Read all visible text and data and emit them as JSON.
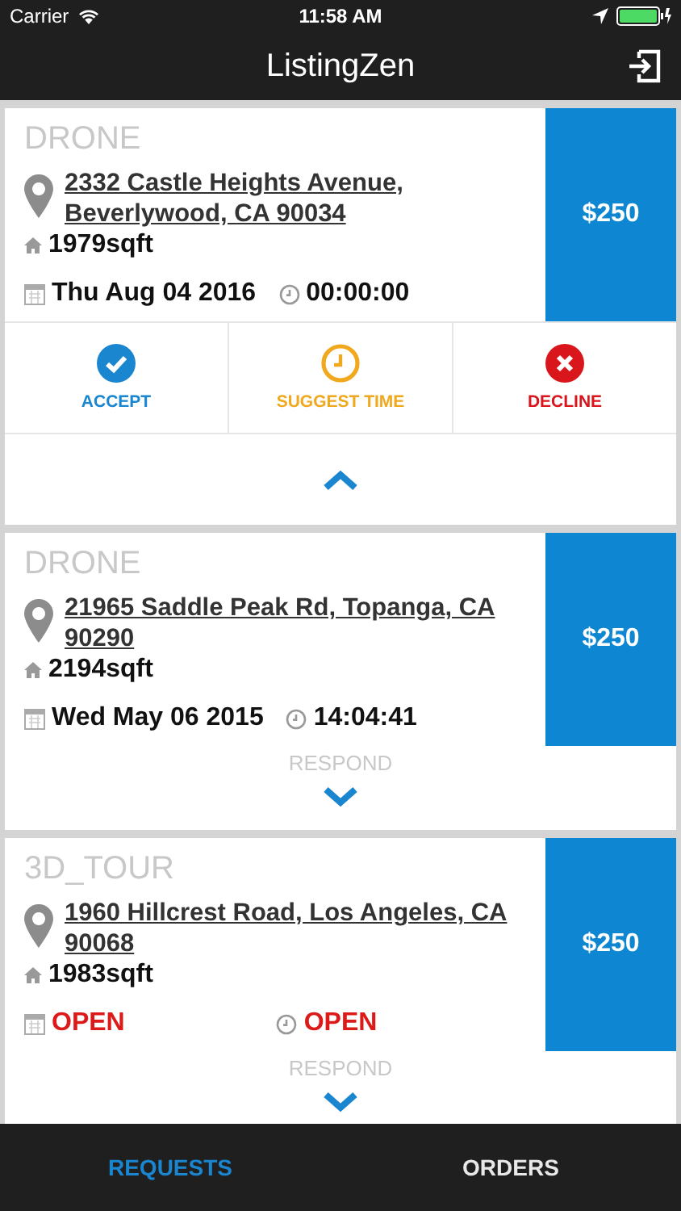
{
  "status_bar": {
    "carrier": "Carrier",
    "time": "11:58 AM"
  },
  "nav": {
    "title": "ListingZen"
  },
  "cards": [
    {
      "type": "DRONE",
      "address": "2332 Castle Heights Avenue, Beverlywood, CA 90034",
      "area": "1979sqft",
      "date": "Thu Aug 04 2016",
      "time": "00:00:00",
      "open": false,
      "price": "$250",
      "expanded": true,
      "actions": [
        {
          "kind": "accept",
          "label": "ACCEPT"
        },
        {
          "kind": "suggest",
          "label": "SUGGEST TIME"
        },
        {
          "kind": "decline",
          "label": "DECLINE"
        }
      ]
    },
    {
      "type": "DRONE",
      "address": "21965 Saddle Peak Rd, Topanga, CA 90290",
      "area": "2194sqft",
      "date": "Wed May 06 2015",
      "time": "14:04:41",
      "open": false,
      "price": "$250",
      "expanded": false,
      "respond": "RESPOND"
    },
    {
      "type": "3D_TOUR",
      "address": "1960 Hillcrest Road, Los Angeles, CA 90068",
      "area": "1983sqft",
      "date": "OPEN",
      "time": "OPEN",
      "open": true,
      "price": "$250",
      "expanded": false,
      "respond": "RESPOND"
    }
  ],
  "tabs": [
    {
      "label": "REQUESTS",
      "selected": true
    },
    {
      "label": "ORDERS",
      "selected": false
    }
  ]
}
